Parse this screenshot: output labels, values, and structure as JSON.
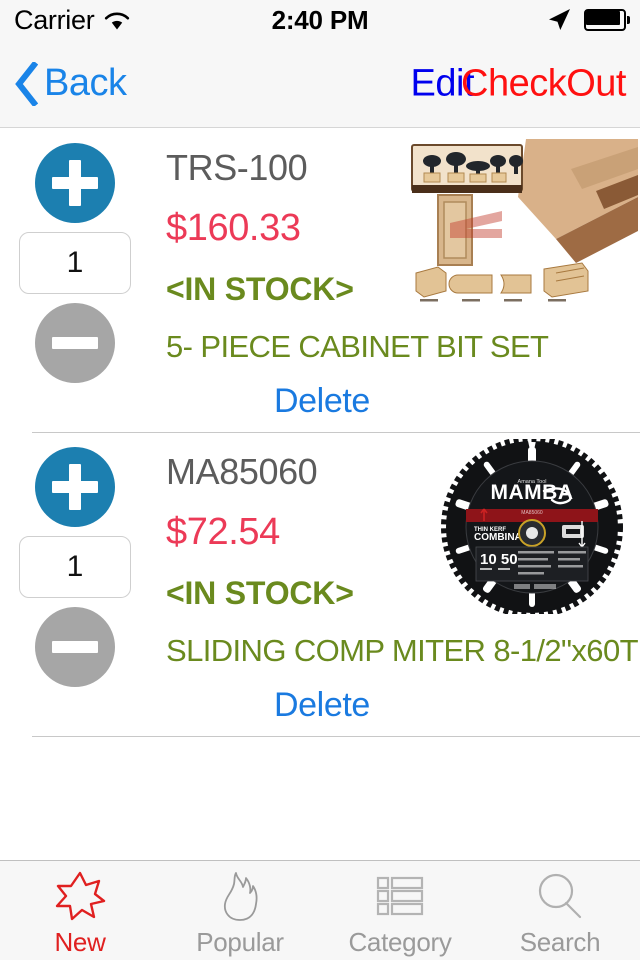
{
  "status_bar": {
    "carrier": "Carrier",
    "wifi_icon": "wifi-icon",
    "time": "2:40 PM",
    "location_icon": "location-arrow-icon",
    "battery_icon": "battery-full-icon"
  },
  "nav_bar": {
    "back_icon": "chevron-left-icon",
    "back_label": "Back",
    "edit_label": "Edit",
    "checkout_label": "CheckOut",
    "edit_color": "#0000ee",
    "checkout_color": "#ff1010",
    "back_color": "#1a84e8"
  },
  "cart": {
    "items": [
      {
        "sku": "TRS-100",
        "price": "$160.33",
        "stock": "<IN STOCK>",
        "description": "5- PIECE CABINET BIT SET",
        "quantity": "1",
        "delete_label": "Delete",
        "increment_icon": "plus-circle-icon",
        "decrement_icon": "minus-circle-icon",
        "thumbnail": "cabinet-router-bit-set-photo"
      },
      {
        "sku": "MA85060",
        "price": "$72.54",
        "stock": "<IN STOCK>",
        "description": "SLIDING COMP MITER 8-1/2\"x60T",
        "quantity": "1",
        "delete_label": "Delete",
        "increment_icon": "plus-circle-icon",
        "decrement_icon": "minus-circle-icon",
        "thumbnail": "mamba-circular-saw-blade-photo"
      }
    ]
  },
  "tab_bar": {
    "tabs": [
      {
        "label": "New",
        "icon": "star-burst-icon",
        "active": true
      },
      {
        "label": "Popular",
        "icon": "flame-icon",
        "active": false
      },
      {
        "label": "Category",
        "icon": "list-rows-icon",
        "active": false
      },
      {
        "label": "Search",
        "icon": "magnifier-icon",
        "active": false
      }
    ]
  },
  "colors": {
    "price": "#ec3a57",
    "stock": "#6a8a1e",
    "sku": "#5c5c5c",
    "link": "#1a7ae0",
    "plus_button": "#1c7fb0",
    "minus_button": "#a6a6a6",
    "tab_active": "#e02020",
    "tab_inactive": "#9a9a9a"
  }
}
